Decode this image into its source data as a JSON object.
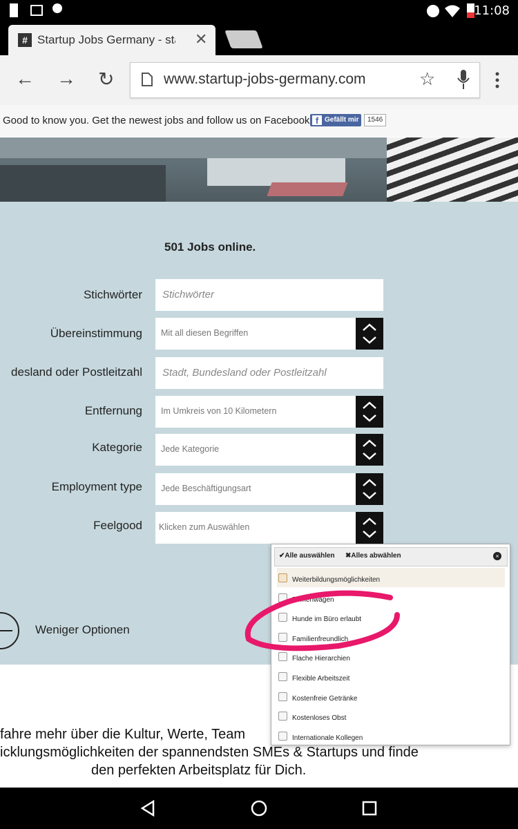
{
  "status": {
    "time": "11:08"
  },
  "tab": {
    "title": "Startup Jobs Germany - start",
    "favicon": "#"
  },
  "toolbar": {
    "url": "www.startup-jobs-germany.com"
  },
  "fbbar": {
    "text": "Good to know you. Get the newest jobs and follow us on Facebook.",
    "like_label": "Gefällt mir",
    "like_count": "1546"
  },
  "form": {
    "headline": "501 Jobs online.",
    "keywords": {
      "label": "Stichwörter",
      "placeholder": "Stichwörter"
    },
    "match": {
      "label": "Übereinstimmung",
      "value": "Mit all diesen Begriffen"
    },
    "location": {
      "label": "desland oder Postleitzahl",
      "placeholder": "Stadt, Bundesland oder Postleitzahl"
    },
    "distance": {
      "label": "Entfernung",
      "value": "Im Umkreis von 10 Kilometern"
    },
    "category": {
      "label": "Kategorie",
      "value": "Jede Kategorie"
    },
    "employment": {
      "label": "Employment type",
      "value": "Jede Beschäftigungsart"
    },
    "feelgood": {
      "label": "Feelgood",
      "value": "Klicken zum Auswählen"
    },
    "less_options": "Weniger Optionen"
  },
  "dropdown": {
    "select_all": "Alle auswählen",
    "deselect_all": "Alles abwählen",
    "options": [
      "Weiterbildungsmöglichkeiten",
      "Firmenwagen",
      "Hunde im Büro erlaubt",
      "Familienfreundlich",
      "Flache Hierarchien",
      "Flexible Arbeitszeit",
      "Kostenfreie Getränke",
      "Kostenloses Obst",
      "Internationale Kollegen"
    ]
  },
  "bottom": {
    "line1": "fahre mehr über die Kultur, Werte, Team",
    "line2": "icklungsmöglichkeiten der spannendsten SMEs & Startups und finde",
    "line3": "den perfekten Arbeitsplatz für Dich."
  },
  "colors": {
    "form_bg": "#c6d8de",
    "annotation": "#e8186a",
    "facebook": "#4a66a0"
  }
}
